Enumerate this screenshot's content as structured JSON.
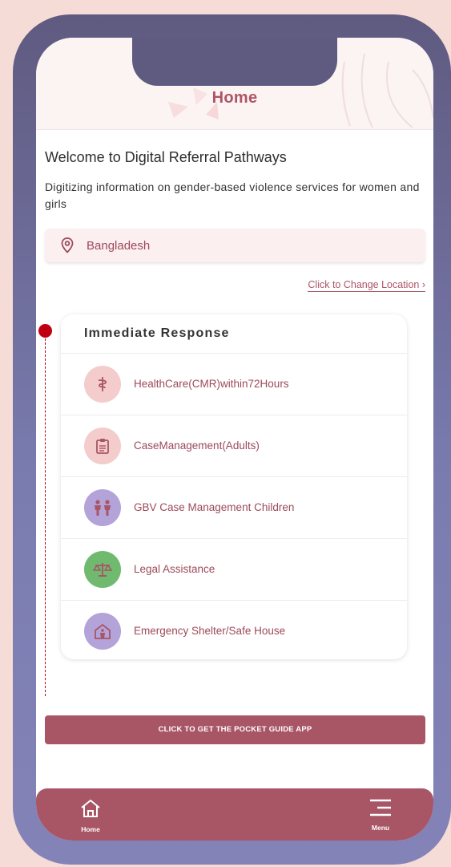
{
  "header": {
    "title": "Home"
  },
  "welcome": {
    "heading": "Welcome to Digital Referral Pathways",
    "subtitle": "Digitizing information on gender-based violence services for women and girls"
  },
  "location": {
    "country": "Bangladesh",
    "change_label": "Click to Change Location ›"
  },
  "immediate_response": {
    "title": "Immediate Response",
    "items": [
      {
        "label": "HealthCare(CMR)within72Hours",
        "icon": "caduceus-icon",
        "color": "#f4cccc"
      },
      {
        "label": "CaseManagement(Adults)",
        "icon": "clipboard-icon",
        "color": "#f4cccc"
      },
      {
        "label": "GBV Case Management Children",
        "icon": "children-icon",
        "color": "#b3a3d9"
      },
      {
        "label": "Legal Assistance",
        "icon": "scales-icon",
        "color": "#6fba6f"
      },
      {
        "label": "Emergency Shelter/Safe House",
        "icon": "shelter-icon",
        "color": "#b3a3d9"
      }
    ]
  },
  "pocket_guide": {
    "label": "CLICK TO GET THE POCKET GUIDE APP"
  },
  "bottom_nav": {
    "home_label": "Home",
    "menu_label": "Menu"
  },
  "colors": {
    "brand": "#a85566",
    "text_accent": "#9c4a5a",
    "timeline": "#c00010"
  }
}
